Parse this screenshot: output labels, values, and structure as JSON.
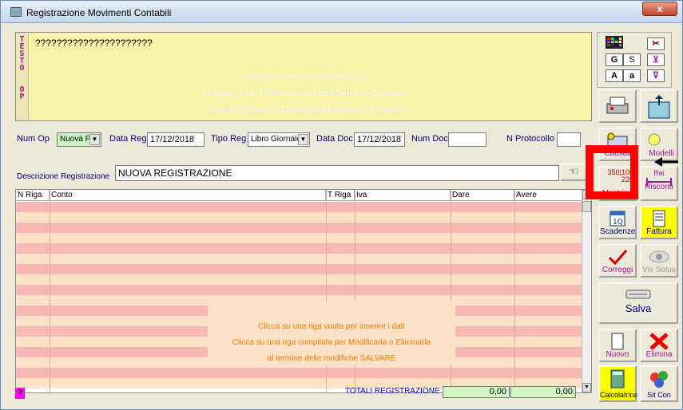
{
  "window": {
    "title": "Registrazione Movimenti Contabili",
    "close": "x"
  },
  "testo": {
    "side_label": "TESTO OP",
    "text": "??????????????????????",
    "hints": [
      "Compilare il Testo dell'Operazione",
      "Compilare i dati dell'Intestazione del Movimento Contabile",
      "Compilare le Righe di Dettaglio del Movimento e Salvare"
    ]
  },
  "toolbar": {
    "g": "G",
    "s": "S",
    "a_upper": "A",
    "a_lower": "a",
    "causali": "Causali",
    "modelli": "Modelli",
    "mastrino": "Mastrino",
    "mastrino_nums": [
      "350",
      "100",
      "220"
    ],
    "risconti": "Risconti",
    "risconti_top": "Rei",
    "scadenze": "Scadenze",
    "fattura": "Fattura",
    "correggi": "Correggi",
    "vis_solus": "Vis Solus",
    "salva": "Salva",
    "nuovo": "Nuovo",
    "elimina": "Elimina",
    "calcolatrice": "Calcolatrice",
    "sitcon": "Sit Con",
    "accent_red": "#ff0000"
  },
  "header": {
    "num_op_label": "Num Op",
    "num_op_value": "Nuova F",
    "data_reg_label": "Data Reg",
    "data_reg_value": "17/12/2018",
    "tipo_reg_label": "Tipo Reg",
    "tipo_reg_value": "Libro Giornale",
    "data_doc_label": "Data Doc",
    "data_doc_value": "17/12/2018",
    "num_doc_label": "Num Doc",
    "num_doc_value": "",
    "protocollo_label": "N Protocollo",
    "protocollo_value": ""
  },
  "descrizione": {
    "label": "Descrizione Registrazione",
    "value": "NUOVA REGISTRAZIONE"
  },
  "grid": {
    "columns": [
      "N Riga",
      "Conto",
      "T Riga",
      "Iva",
      "Dare",
      "Avere"
    ],
    "hints": [
      "Clicca su una riga vuota per inserire i dati",
      "Clicca su una riga compilata per Modificarla o Eliminarla",
      "al termine delle modifiche SALVARE"
    ]
  },
  "totals": {
    "label": "TOTALI REGISTRAZIONE",
    "dare": "0,00",
    "avere": "0,00"
  },
  "help": "?"
}
